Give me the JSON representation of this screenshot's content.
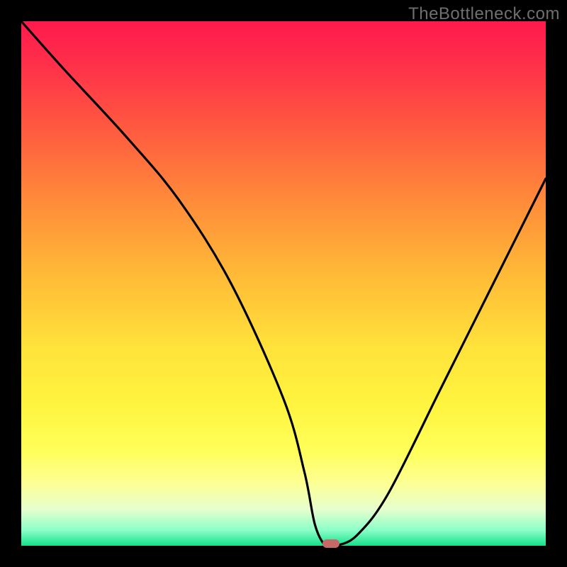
{
  "watermark": "TheBottleneck.com",
  "chart_data": {
    "type": "line",
    "title": "",
    "xlabel": "",
    "ylabel": "",
    "xlim": [
      0,
      100
    ],
    "ylim": [
      0,
      100
    ],
    "grid": false,
    "legend": false,
    "background": "red-yellow-green-vertical-gradient",
    "series": [
      {
        "name": "bottleneck-curve",
        "x": [
          0,
          8,
          20,
          30,
          40,
          50,
          54,
          56,
          58,
          60,
          64,
          70,
          80,
          90,
          100
        ],
        "y": [
          100,
          91,
          78,
          66,
          50,
          28,
          14,
          4,
          0,
          0,
          2,
          10,
          30,
          50,
          70
        ]
      }
    ],
    "marker": {
      "x_percent": 59,
      "y_percent": 0,
      "color": "#c76a67"
    },
    "colors": {
      "curve": "#000000",
      "frame": "#000000",
      "top": "#ff1a4d",
      "mid": "#ffe23a",
      "bottom": "#15e08a"
    }
  }
}
